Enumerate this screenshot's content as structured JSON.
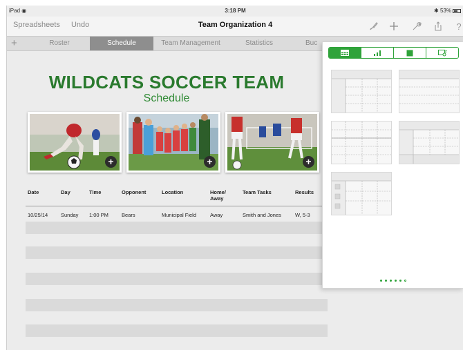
{
  "status": {
    "carrier": "iPad",
    "time": "3:18 PM",
    "battery": "53%"
  },
  "toolbar": {
    "spreadsheets": "Spreadsheets",
    "undo": "Undo",
    "title": "Team Organization 4",
    "icons": [
      "brush-icon",
      "plus-icon",
      "wrench-icon",
      "share-icon",
      "help-icon"
    ]
  },
  "tabs": {
    "add": "+",
    "items": [
      "Roster",
      "Schedule",
      "Team Management",
      "Statistics",
      "Buc"
    ],
    "active_index": 1
  },
  "sheet": {
    "title": "WILDCATS SOCCER TEAM",
    "subtitle": "Schedule",
    "photo_add": "+",
    "columns": [
      "Date",
      "Day",
      "Time",
      "Opponent",
      "Location",
      "Home/\nAway",
      "Team Tasks",
      "Results"
    ],
    "rows": [
      [
        "10/25/14",
        "Sunday",
        "1:00 PM",
        "Bears",
        "Municipal Field",
        "Away",
        "Smith and Jones",
        "W, 5-3"
      ]
    ]
  },
  "popover": {
    "segments": [
      "table-icon",
      "chart-icon",
      "shape-icon",
      "media-icon"
    ],
    "selected_segment": 0,
    "page_dots": 6,
    "current_page": 5
  },
  "colors": {
    "accent_green": "#2fa33a",
    "title_green": "#2a7a2e"
  }
}
